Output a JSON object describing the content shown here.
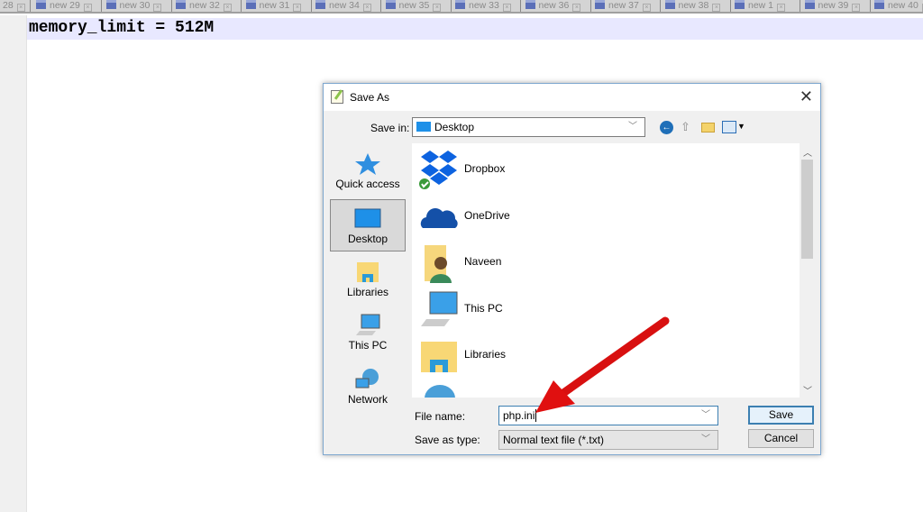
{
  "tabs": [
    {
      "label": "28"
    },
    {
      "label": "new 29"
    },
    {
      "label": "new 30"
    },
    {
      "label": "new 32"
    },
    {
      "label": "new 31"
    },
    {
      "label": "new 34"
    },
    {
      "label": "new 35"
    },
    {
      "label": "new 33"
    },
    {
      "label": "new 36"
    },
    {
      "label": "new 37"
    },
    {
      "label": "new 38"
    },
    {
      "label": "new 1"
    },
    {
      "label": "new 39"
    },
    {
      "label": "new 40"
    }
  ],
  "editor": {
    "line1": "memory_limit = 512M"
  },
  "dialog": {
    "title": "Save As",
    "save_in_label": "Save in:",
    "save_in_value": "Desktop",
    "sidebar": [
      {
        "label": "Quick access",
        "icon": "star-icon"
      },
      {
        "label": "Desktop",
        "icon": "desktop-icon"
      },
      {
        "label": "Libraries",
        "icon": "libraries-icon"
      },
      {
        "label": "This PC",
        "icon": "computer-icon"
      },
      {
        "label": "Network",
        "icon": "network-icon"
      }
    ],
    "files": [
      {
        "name": "Dropbox",
        "icon": "dropbox-icon"
      },
      {
        "name": "OneDrive",
        "icon": "onedrive-icon"
      },
      {
        "name": "Naveen",
        "icon": "user-folder-icon"
      },
      {
        "name": "This PC",
        "icon": "computer-icon"
      },
      {
        "name": "Libraries",
        "icon": "libraries-icon"
      }
    ],
    "file_name_label": "File name:",
    "file_name_value": "php.ini",
    "save_type_label": "Save as type:",
    "save_type_value": "Normal text file (*.txt)",
    "save_button": "Save",
    "cancel_button": "Cancel"
  },
  "colors": {
    "accent": "#3c7fb1",
    "arrow": "#e01010",
    "current_line": "#e8e8ff"
  }
}
